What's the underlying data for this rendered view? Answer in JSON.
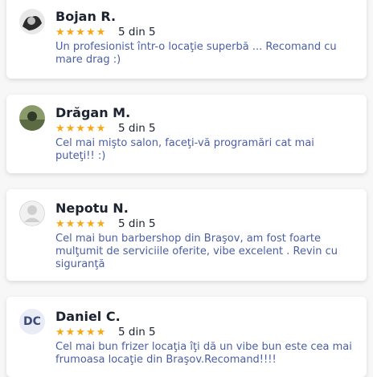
{
  "reviews": [
    {
      "name": "Bojan R.",
      "stars": "★★★★★",
      "rating": "5 din 5",
      "text": "Un profesionist într-o locaţie superbă ... Recomand cu mare drag :)",
      "avatar": "photo"
    },
    {
      "name": "Drăgan M.",
      "stars": "★★★★★",
      "rating": "5 din 5",
      "text": "Cel mai mişto salon, faceţi-vă programări cat mai puteţi!! :)",
      "avatar": "photo"
    },
    {
      "name": "Nepotu N.",
      "stars": "★★★★★",
      "rating": "5 din 5",
      "text": "Cel mai bun barbershop din Braşov, am fost foarte mulţumit de serviciile oferite, vibe excelent . Revin cu siguranţă",
      "avatar": "placeholder"
    },
    {
      "name": "Daniel C.",
      "stars": "★★★★★",
      "rating": "5 din 5",
      "text": "Cel mai bun frizer locaţia îţi dă un vibe bun este cea mai frumoasa locaţie din Braşov.Recomand!!!!",
      "avatar": "initials",
      "initials": "DC"
    }
  ],
  "colors": {
    "star": "#f6a817",
    "text": "#4a5fa3",
    "name": "#1c2230"
  }
}
